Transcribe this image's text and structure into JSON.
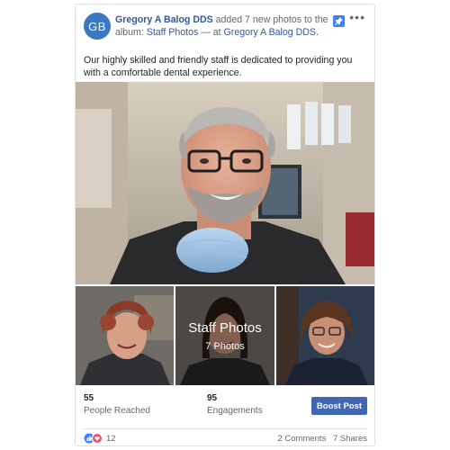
{
  "post": {
    "avatar_initials": "GB",
    "page_name": "Gregory A Balog DDS",
    "action_text": " added 7 new photos to the album: ",
    "album_link": "Staff Photos",
    "at_text": " — at ",
    "location_link": "Gregory A Balog DDS.",
    "more_label": "•••",
    "body_text": "Our highly skilled and friendly staff is dedicated to providing you with a comfortable dental experience."
  },
  "album": {
    "title": "Staff Photos",
    "count": "7 Photos"
  },
  "stats": {
    "reached_value": "55",
    "reached_label": "People Reached",
    "engagements_value": "95",
    "engagements_label": "Engagements",
    "boost_label": "Boost Post"
  },
  "footer": {
    "reaction_count": "12",
    "comments": "2 Comments",
    "shares": "7 Shares"
  },
  "colors": {
    "link": "#365899",
    "avatar": "#3b78c2",
    "boost": "#4267b2",
    "like": "#4080ff",
    "love": "#f25268"
  },
  "icons": {
    "pin": "pin-icon",
    "more": "more-icon",
    "like": "like-icon",
    "love": "love-icon"
  }
}
